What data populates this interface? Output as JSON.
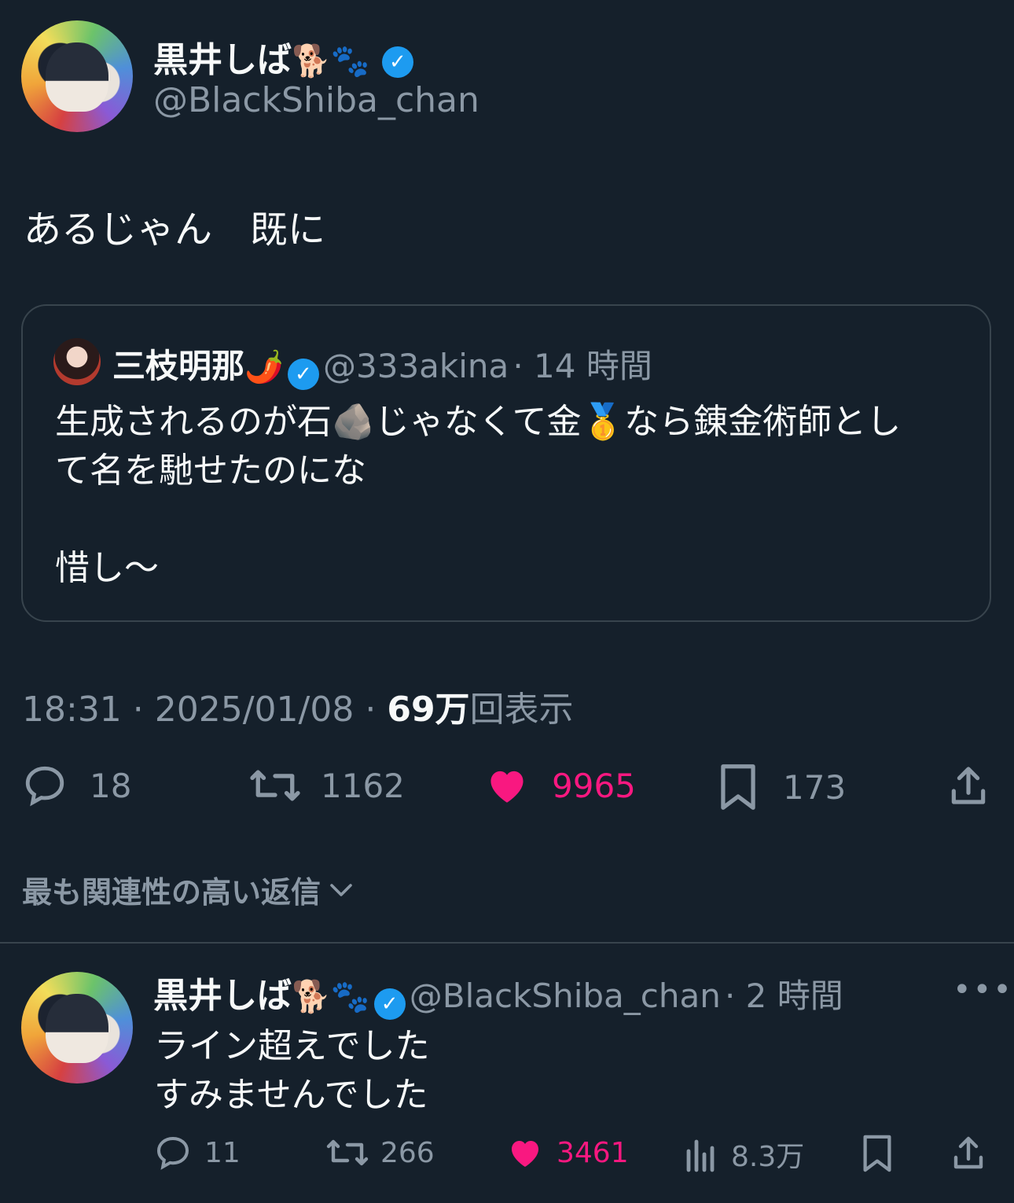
{
  "main_tweet": {
    "display_name": "黒井しば",
    "name_emojis": "🐕🐾",
    "handle": "@BlackShiba_chan",
    "text": "あるじゃん　既に",
    "quote": {
      "display_name": "三枝明那",
      "name_emoji": "🌶️",
      "handle": "@333akina",
      "time": "· 14 時間",
      "line1": "生成されるのが石🪨じゃなくて金🥇なら錬金術師とし",
      "line2": "て名を馳せたのにな",
      "line3": "惜し〜"
    },
    "timestamp": "18:31 · 2025/01/08 · ",
    "views_count": "69万",
    "views_label": "回表示",
    "actions": {
      "replies": "18",
      "retweets": "1162",
      "likes": "9965",
      "bookmarks": "173"
    }
  },
  "replies_sort_label": "最も関連性の高い返信",
  "reply": {
    "display_name": "黒井しば",
    "name_emojis": "🐕🐾",
    "handle": "@BlackShiba_chan",
    "time": "· 2 時間",
    "line1": "ライン超えでした",
    "line2": "すみませんでした",
    "actions": {
      "replies": "11",
      "retweets": "266",
      "likes": "3461",
      "views": "8.3万"
    }
  },
  "colors": {
    "background": "#15202b",
    "secondary_text": "#8b98a5",
    "like_pink": "#f91880",
    "verified_blue": "#1d9bf0"
  }
}
